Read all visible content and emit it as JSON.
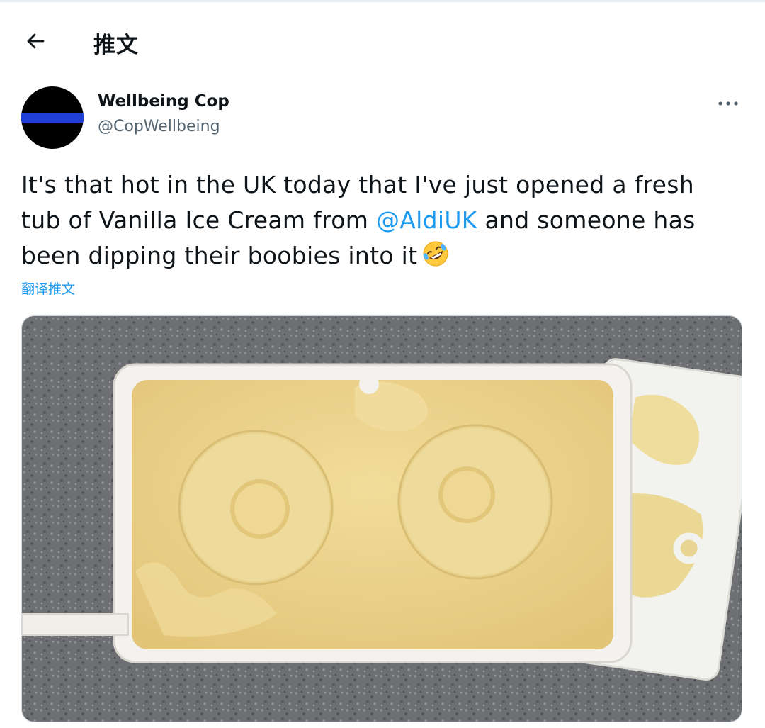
{
  "header": {
    "title": "推文",
    "back_icon": "arrow-left-icon"
  },
  "tweet": {
    "author": {
      "display_name": "Wellbeing Cop",
      "handle": "@CopWellbeing"
    },
    "text": {
      "part1": "It's that hot in the UK today that I've just opened a fresh tub of Vanilla Ice Cream from ",
      "mention": "@AldiUK",
      "part2": " and someone has been dipping their boobies into it",
      "emoji": "rolling-on-floor-laughing-emoji"
    },
    "translate_label": "翻译推文",
    "more_icon": "more-horizontal-icon",
    "media": {
      "description_icon": "photo",
      "colors": {
        "counter": "#6e6f72",
        "tub": "#f4f2ee",
        "ice_cream": "#eed690"
      }
    }
  },
  "colors": {
    "accent": "#1d9bf0",
    "text": "#0f1419",
    "secondary": "#536471"
  }
}
